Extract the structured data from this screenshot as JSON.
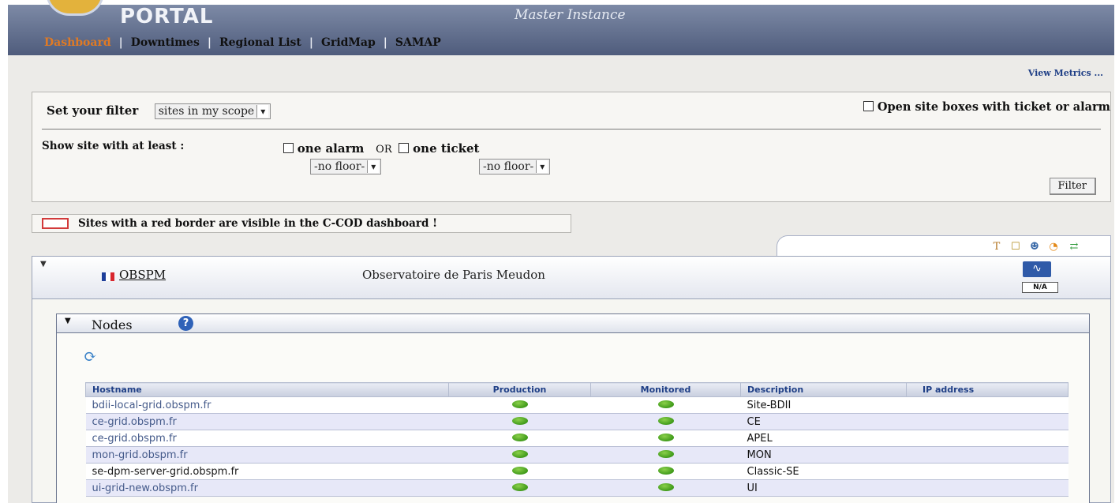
{
  "header": {
    "portal_title": "PORTAL",
    "instance": "Master Instance",
    "nav": [
      {
        "label": "Dashboard",
        "active": true
      },
      {
        "label": "Downtimes",
        "active": false
      },
      {
        "label": "Regional List",
        "active": false
      },
      {
        "label": "GridMap",
        "active": false
      },
      {
        "label": "SAMAP",
        "active": false
      }
    ],
    "separator": "|"
  },
  "view_metrics": "View Metrics ...",
  "filter": {
    "set_filter_label": "Set your filter",
    "scope_select": "sites in my scope",
    "open_boxes_label": "Open site boxes with ticket or alarm",
    "show_site_label": "Show site with at least :",
    "one_alarm_label": "one alarm",
    "or_label": "OR",
    "one_ticket_label": "one ticket",
    "alarm_floor": "-no floor-",
    "ticket_floor": "-no floor-",
    "filter_button": "Filter"
  },
  "legend_note": "Sites with a red border are visible in the C-COD dashboard !",
  "site": {
    "name": "OBSPM",
    "description": "Observatoire de Paris Meudon",
    "status_badge": "N/A"
  },
  "nodes": {
    "title": "Nodes",
    "help": "?",
    "columns": {
      "hostname": "Hostname",
      "production": "Production",
      "monitored": "Monitored",
      "description": "Description",
      "ip": "IP address"
    },
    "rows": [
      {
        "hostname": "bdii-local-grid.obspm.fr",
        "description": "Site-BDII",
        "ip": ""
      },
      {
        "hostname": "ce-grid.obspm.fr",
        "description": "CE",
        "ip": ""
      },
      {
        "hostname": "ce-grid.obspm.fr",
        "description": "APEL",
        "ip": ""
      },
      {
        "hostname": "mon-grid.obspm.fr",
        "description": "MON",
        "ip": ""
      },
      {
        "hostname": "se-dpm-server-grid.obspm.fr",
        "description": "Classic-SE",
        "ip": ""
      },
      {
        "hostname": "ui-grid-new.obspm.fr",
        "description": "UI",
        "ip": ""
      }
    ]
  },
  "colors": {
    "nav_active": "#e07a24",
    "status_ok": "#3f9a1a",
    "red_border": "#d23a3a",
    "link": "#1f3f86"
  },
  "icons": {
    "tools": [
      "ticket-add-icon",
      "notes-icon",
      "contact-icon",
      "rss-icon",
      "sync-icon"
    ],
    "monitor": "monitor-icon",
    "refresh": "refresh-icon"
  }
}
